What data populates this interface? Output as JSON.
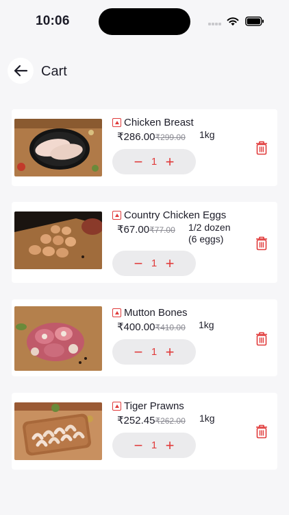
{
  "status_bar": {
    "time": "10:06"
  },
  "header": {
    "title": "Cart"
  },
  "icons": {
    "back": "arrow-left-icon",
    "delete": "trash-icon",
    "non_veg": "non-veg-mark-icon",
    "minus": "minus-icon",
    "plus": "plus-icon"
  },
  "colors": {
    "accent": "#e03a3a",
    "background": "#f6f6f8",
    "card": "#ffffff",
    "stepper": "#ebebed"
  },
  "cart": {
    "items": [
      {
        "name": "Chicken Breast",
        "price": "₹286.00",
        "mrp": "₹299.00",
        "unit": "1kg",
        "quantity": "1",
        "minus": "−",
        "plus": "+"
      },
      {
        "name": "Country Chicken Eggs",
        "price": "₹67.00",
        "mrp": "₹77.00",
        "unit": "1/2 dozen",
        "unit_detail": "(6 eggs)",
        "quantity": "1",
        "minus": "−",
        "plus": "+"
      },
      {
        "name": "Mutton Bones",
        "price": "₹400.00",
        "mrp": "₹410.00",
        "unit": "1kg",
        "quantity": "1",
        "minus": "−",
        "plus": "+"
      },
      {
        "name": "Tiger Prawns",
        "price": "₹252.45",
        "mrp": "₹262.00",
        "unit": "1kg",
        "quantity": "1",
        "minus": "−",
        "plus": "+"
      }
    ]
  }
}
